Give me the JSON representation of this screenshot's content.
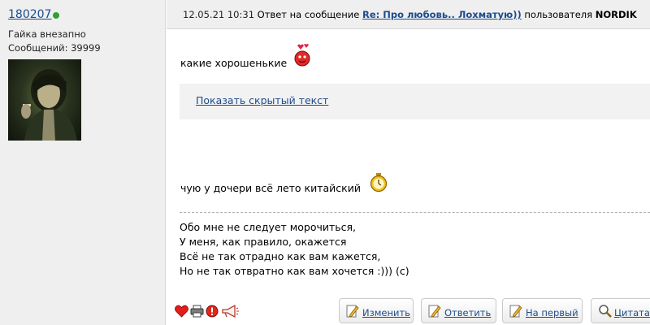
{
  "user": {
    "username": "180207",
    "online": true,
    "title": "Гайка внезапно",
    "posts_label": "Сообщений: 39999"
  },
  "header": {
    "datetime": "12.05.21 10:31",
    "reply_prefix": "Ответ на сообщение",
    "reply_link": "Re: Про любовь.. Лохматую))",
    "user_prefix": "пользователя",
    "reply_author": "NORDIK"
  },
  "post": {
    "line1": "какие хорошенькие",
    "spoiler_label": "Показать скрытый текст",
    "line2": "чую у дочери всё лето китайский",
    "signature": [
      "Обо мне не следует морочиться,",
      "У меня, как правило, окажется",
      "Всё не так отрадно как вам кажется,",
      "Но не так отвратно как вам хочется :))) (с)"
    ]
  },
  "actions": {
    "icons": [
      "heart-icon",
      "print-icon",
      "warning-icon",
      "megaphone-icon"
    ],
    "edit_label": "Изменить",
    "reply_label": "Ответить",
    "first_label": "На первый",
    "quote_label": "Цитата"
  },
  "colors": {
    "link": "#1d4c8c",
    "online": "#2fa12c",
    "panel": "#efefef"
  }
}
